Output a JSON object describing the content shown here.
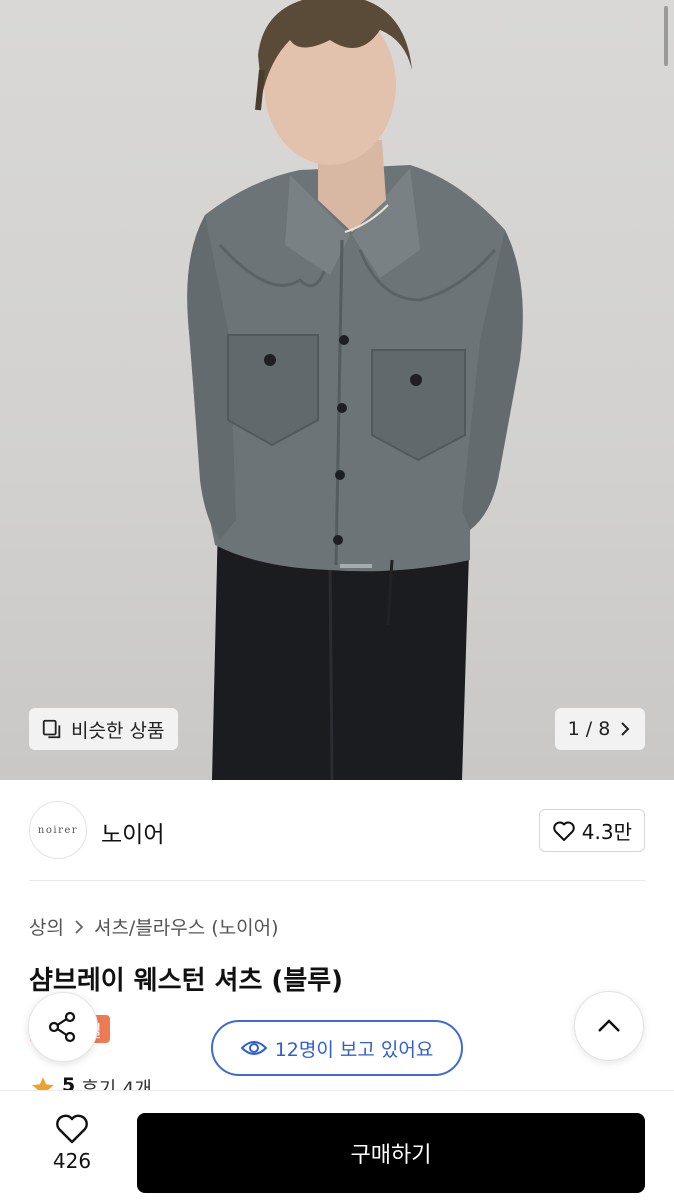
{
  "gallery": {
    "similar_label": "비슷한 상품",
    "page_indicator": "1 / 8"
  },
  "brand": {
    "logo_text": "noirer",
    "name": "노이어",
    "like_count": "4.3만"
  },
  "product": {
    "breadcrumb": [
      "상의",
      "셔츠/블라우스 (노이어)"
    ],
    "title": "샴브레이 웨스턴 셔츠 (블루)",
    "badge": "일",
    "rating": "5",
    "review_label": "후기 4개"
  },
  "overlay": {
    "viewers_text": "12명이 보고 있어요"
  },
  "bottom_bar": {
    "wish_count": "426",
    "buy_label": "구매하기"
  },
  "colors": {
    "buy_button": "#000000",
    "viewers_accent": "#2f5fd0",
    "badge": "#f07a55",
    "star": "#f0a030"
  }
}
